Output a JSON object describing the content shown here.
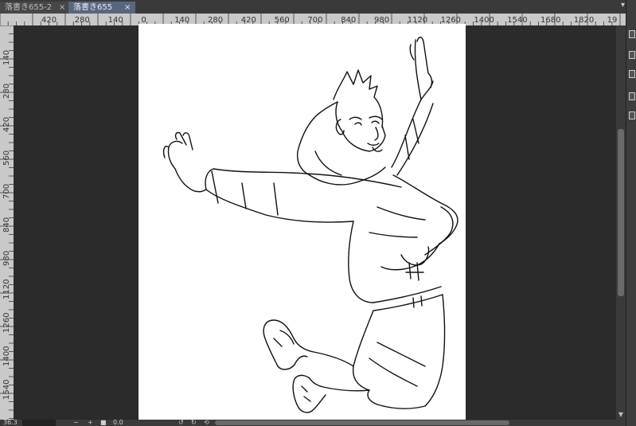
{
  "tabs": [
    {
      "label": "落書き655-2",
      "close": "×",
      "active": false
    },
    {
      "label": "落書き655",
      "close": "×",
      "active": true
    }
  ],
  "tab_menu_icon": "chevron-down-icon",
  "rulers": {
    "horizontal_labels": [
      "420",
      "280",
      "140",
      "0",
      "140",
      "280",
      "420",
      "560",
      "700",
      "840",
      "980",
      "1120",
      "1260",
      "1400",
      "1540",
      "1680",
      "1820",
      "19"
    ],
    "vertical_labels": [
      "140",
      "280",
      "420",
      "560",
      "700",
      "840",
      "980",
      "1120",
      "1260",
      "1400",
      "1540"
    ]
  },
  "status": {
    "zoom_value": "36.3",
    "minus": "−",
    "plus": "+",
    "angle_value": "0.0",
    "rotate_left_icon": "rotate-left-icon",
    "rotate_right_icon": "rotate-right-icon",
    "reset_rotation_icon": "reset-rotation-icon"
  },
  "colors": {
    "pasteboard": "#2b2b2b",
    "active_tab": "#5a6680",
    "ruler": "#c9c9c9",
    "canvas": "#ffffff"
  }
}
